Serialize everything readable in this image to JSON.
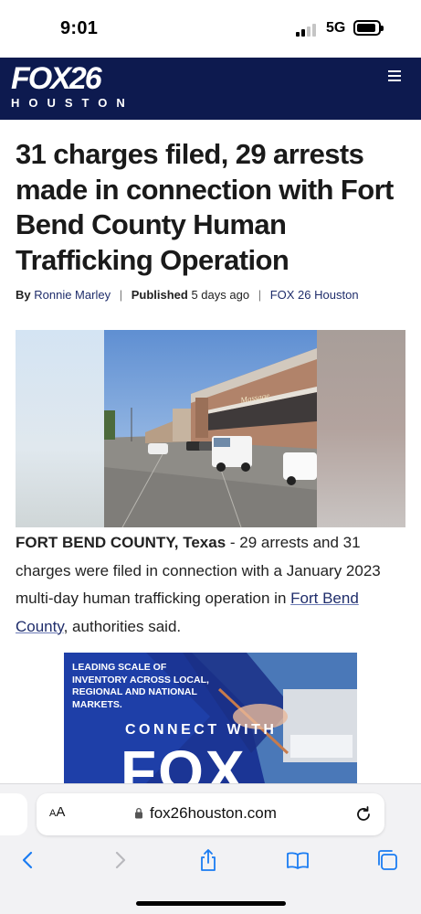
{
  "status_bar": {
    "time": "9:01",
    "network": "5G",
    "signal_bars": 2,
    "signal_icon": "cellular-signal-icon",
    "battery_icon": "battery-icon"
  },
  "header": {
    "logo_main": "FOX26",
    "logo_sub": "HOUSTON",
    "menu_icon": "hamburger-menu-icon",
    "background_color": "#0d1a4f"
  },
  "article": {
    "headline": "31 charges filed, 29 arrests made in connection with Fort Bend County Human Trafficking Operation",
    "byline": {
      "by_label": "By",
      "author": "Ronnie Marley",
      "published_label": "Published",
      "published_time": "5 days ago",
      "source": "FOX 26 Houston"
    },
    "body": {
      "dateline": "FORT BEND COUNTY, Texas",
      "text_before_link": " - 29 arrests and 31 charges were filed in connection with a January 2023 multi-day human trafficking operation in ",
      "link_text": "Fort Bend County",
      "text_after_link": ", authorities said."
    },
    "hero_sign_text": "Massage"
  },
  "ad": {
    "headline": "LEADING SCALE OF INVENTORY ACROSS LOCAL, REGIONAL AND NATIONAL MARKETS.",
    "connect_text": "CONNECT WITH",
    "logo_text": "FOX"
  },
  "browser": {
    "aa_label": "AA",
    "url": "fox26houston.com",
    "accent_color": "#1a7cf2",
    "icons": [
      "back-icon",
      "forward-icon",
      "share-icon",
      "bookmarks-icon",
      "tabs-icon"
    ]
  }
}
